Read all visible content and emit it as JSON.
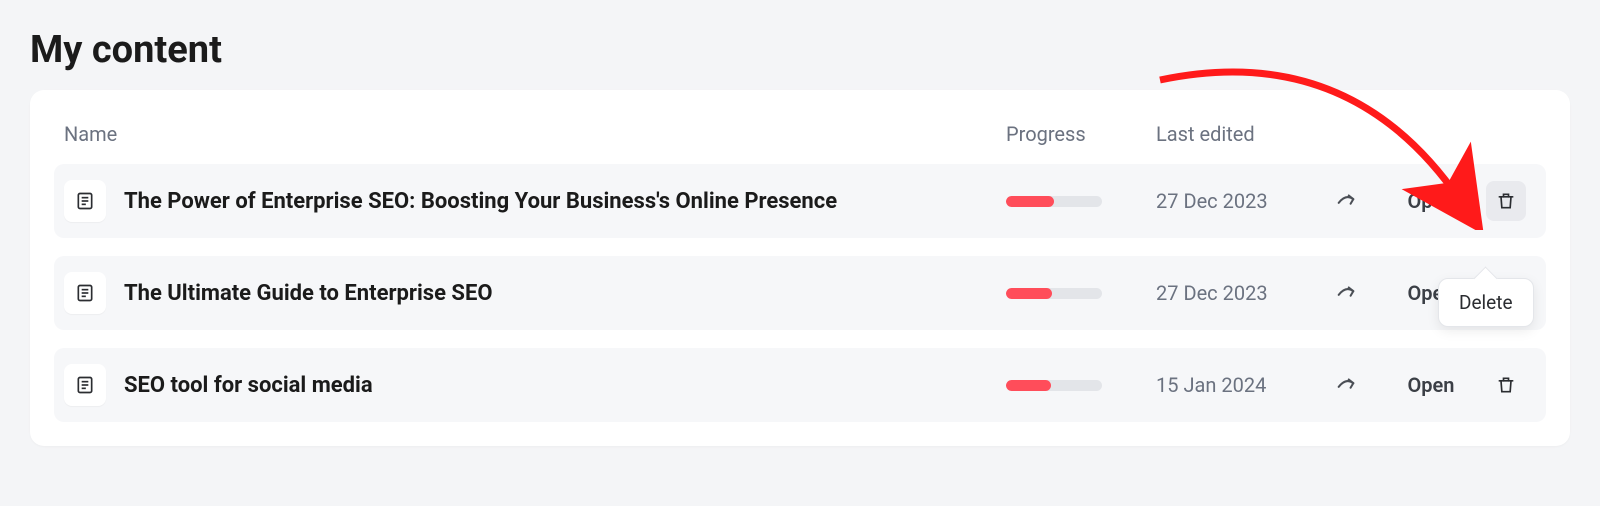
{
  "page_title": "My content",
  "columns": {
    "name": "Name",
    "progress": "Progress",
    "edited": "Last edited"
  },
  "open_label": "Open",
  "tooltip_delete": "Delete",
  "rows": [
    {
      "title": "The Power of Enterprise SEO: Boosting Your Business's Online Presence",
      "progress_pct": 50,
      "edited": "27 Dec 2023",
      "trash_hover": true
    },
    {
      "title": "The Ultimate Guide to Enterprise SEO",
      "progress_pct": 48,
      "edited": "27 Dec 2023",
      "trash_hover": false
    },
    {
      "title": "SEO tool for social media",
      "progress_pct": 47,
      "edited": "15 Jan 2024",
      "trash_hover": false
    }
  ]
}
